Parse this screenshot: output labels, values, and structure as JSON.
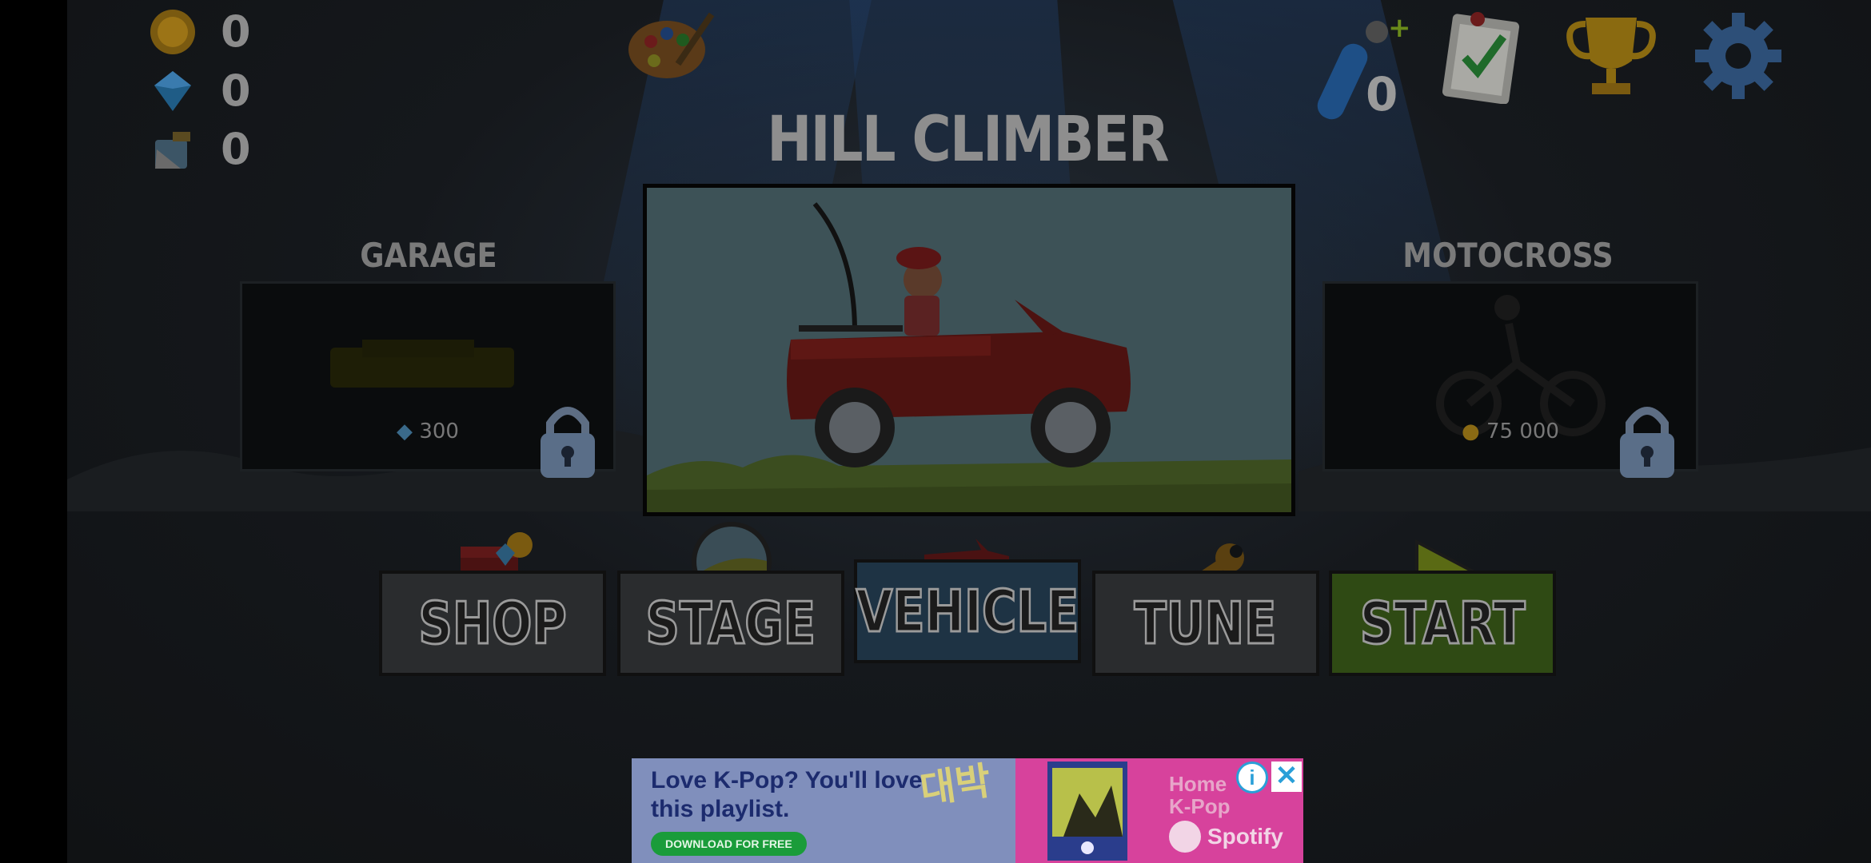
{
  "currencies": [
    {
      "icon": "coin-icon",
      "value": "0"
    },
    {
      "icon": "gem-icon",
      "value": "0"
    },
    {
      "icon": "fuel-can-icon",
      "value": "0"
    }
  ],
  "top_right": {
    "fuel_boost_count": "0"
  },
  "selected_vehicle": {
    "title": "HILL CLIMBER"
  },
  "left_vehicle": {
    "name": "GARAGE",
    "price": "300",
    "price_icon": "gem-icon"
  },
  "right_vehicle": {
    "name": "MOTOCROSS BIKE",
    "price": "75 000",
    "price_icon": "coin-icon"
  },
  "menu": {
    "shop": "SHOP",
    "stage": "STAGE",
    "vehicle": "VEHICLE",
    "tune": "TUNE",
    "start": "START"
  },
  "ad": {
    "headline": "Love K-Pop? You'll love this playlist.",
    "cta": "DOWNLOAD FOR FREE",
    "playlist": "Home K-Pop",
    "brand": "Spotify",
    "korean_text": "대박",
    "info": "i",
    "close": "✕"
  },
  "colors": {
    "start_green": "#2f4a14",
    "vehicle_blue": "#1e3344",
    "ad_pink": "#d7429c"
  }
}
